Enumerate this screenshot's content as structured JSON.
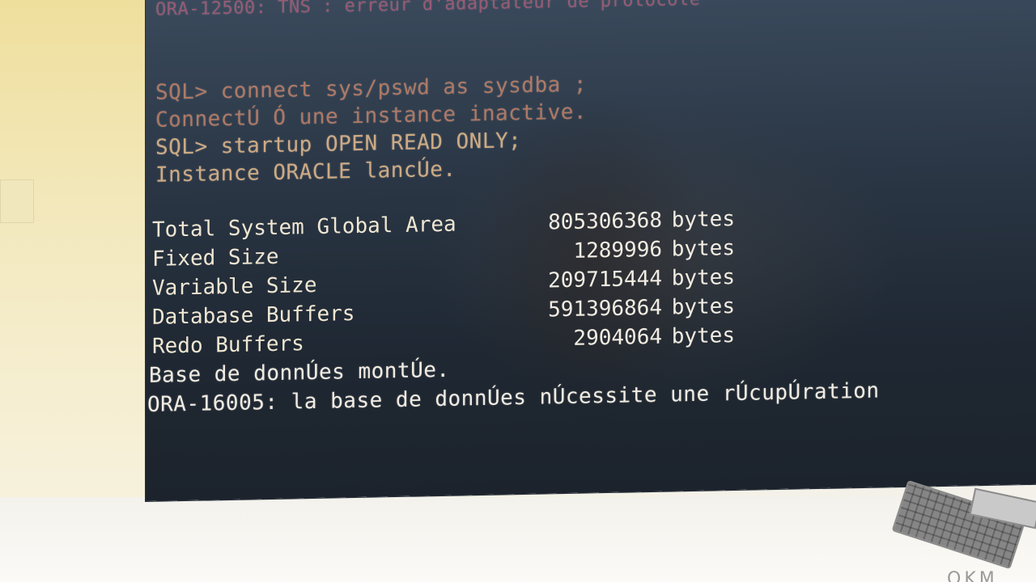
{
  "terminal": {
    "line_top_faded": "ORA-12500: TNS : erreur d'adaptateur de protocole",
    "line_connect_cmd": "SQL> connect sys/pswd as sysdba ;",
    "line_connected": "ConnectÚ Ó une instance inactive.",
    "line_startup_cmd": "SQL> startup OPEN READ ONLY;",
    "line_instance_started": "Instance ORACLE lancÚe.",
    "memory": [
      {
        "label": "Total System Global Area",
        "value": "805306368",
        "unit": "bytes"
      },
      {
        "label": "Fixed Size",
        "value": "1289996",
        "unit": "bytes"
      },
      {
        "label": "Variable Size",
        "value": "209715444",
        "unit": "bytes"
      },
      {
        "label": "Database Buffers",
        "value": "591396864",
        "unit": "bytes"
      },
      {
        "label": "Redo Buffers",
        "value": "2904064",
        "unit": "bytes"
      }
    ],
    "line_mounted": "Base de donnÚes montÚe.",
    "line_error": "ORA-16005: la base de donnÚes nÚcessite une rÚcupÚration",
    "prompt": "SQL>"
  },
  "desk": {
    "corner_text": "OKM"
  }
}
